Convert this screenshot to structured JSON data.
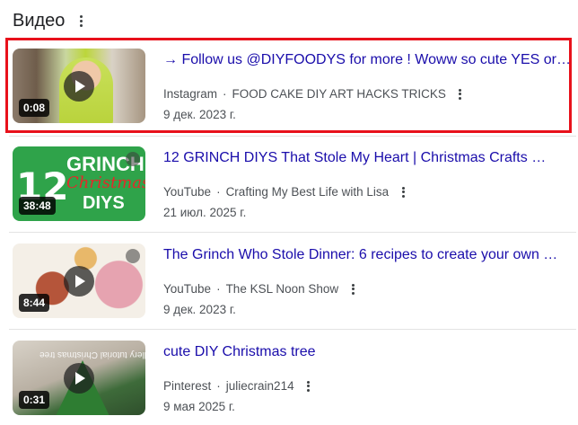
{
  "section": {
    "title": "Видео"
  },
  "videos": [
    {
      "title": "→ Follow us @DIYFOODYS for more ! Woww so cute YES or …",
      "source": "Instagram",
      "channel": "FOOD CAKE DIY ART HACKS TRICKS",
      "date": "9 дек. 2023 г.",
      "duration": "0:08",
      "highlighted": true
    },
    {
      "title": "12 GRINCH DIYS That Stole My Heart | Christmas Crafts …",
      "source": "YouTube",
      "channel": "Crafting My Best Life with Lisa",
      "date": "21 июл. 2025 г.",
      "duration": "38:48",
      "thumb_text": {
        "number": "12",
        "line1": "GRINCH",
        "line2": "Christmas",
        "line3": "DIYS"
      }
    },
    {
      "title": "The Grinch Who Stole Dinner: 6 recipes to create your own …",
      "source": "YouTube",
      "channel": "The KSL Noon Show",
      "date": "9 дек. 2023 г.",
      "duration": "8:44"
    },
    {
      "title": "cute DIY Christmas tree",
      "source": "Pinterest",
      "channel": "juliecrain214",
      "date": "9 мая 2025 г.",
      "duration": "0:31",
      "thumb_text": {
        "overlay": "floristallery tutorial Christmas tree"
      }
    }
  ],
  "colors": {
    "title_link": "#1a0dab",
    "meta": "#4d5156",
    "highlight_border": "#e8111b"
  }
}
